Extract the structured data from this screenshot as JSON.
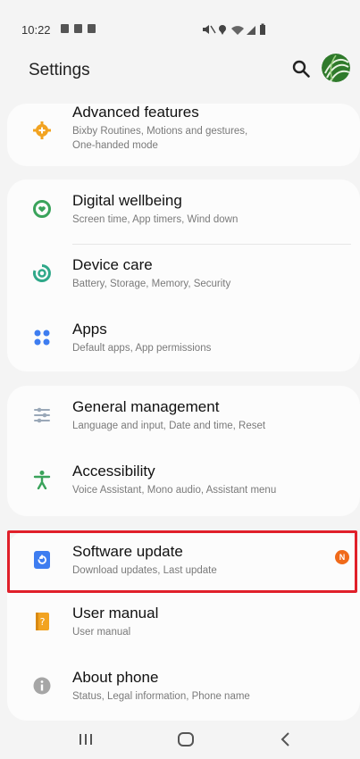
{
  "status_bar": {
    "time": "10:22"
  },
  "header": {
    "title": "Settings"
  },
  "groups": [
    {
      "items": [
        {
          "title": "Advanced features",
          "subtitle_lines": [
            "Bixby Routines, Motions and gestures,",
            "One-handed mode"
          ],
          "icon": "gear-plus-icon"
        }
      ]
    },
    {
      "items": [
        {
          "title": "Digital wellbeing",
          "subtitle": "Screen time, App timers, Wind down",
          "icon": "wellbeing-icon"
        },
        {
          "title": "Device care",
          "subtitle": "Battery, Storage, Memory, Security",
          "icon": "device-care-icon"
        },
        {
          "title": "Apps",
          "subtitle": "Default apps, App permissions",
          "icon": "apps-grid-icon"
        }
      ]
    },
    {
      "items": [
        {
          "title": "General management",
          "subtitle": "Language and input, Date and time, Reset",
          "icon": "sliders-icon"
        },
        {
          "title": "Accessibility",
          "subtitle": "Voice Assistant, Mono audio, Assistant menu",
          "icon": "accessibility-icon"
        }
      ]
    },
    {
      "items": [
        {
          "title": "Software update",
          "subtitle": "Download updates, Last update",
          "icon": "update-icon",
          "badge": "N"
        },
        {
          "title": "User manual",
          "subtitle": "User manual",
          "icon": "manual-icon"
        },
        {
          "title": "About phone",
          "subtitle": "Status, Legal information, Phone name",
          "icon": "info-icon"
        }
      ]
    }
  ],
  "colors": {
    "highlight": "#e0202a",
    "badge": "#f06a1a",
    "accent_blue": "#3e7df0",
    "accent_green": "#3aa35b",
    "accent_orange": "#f2a321"
  }
}
